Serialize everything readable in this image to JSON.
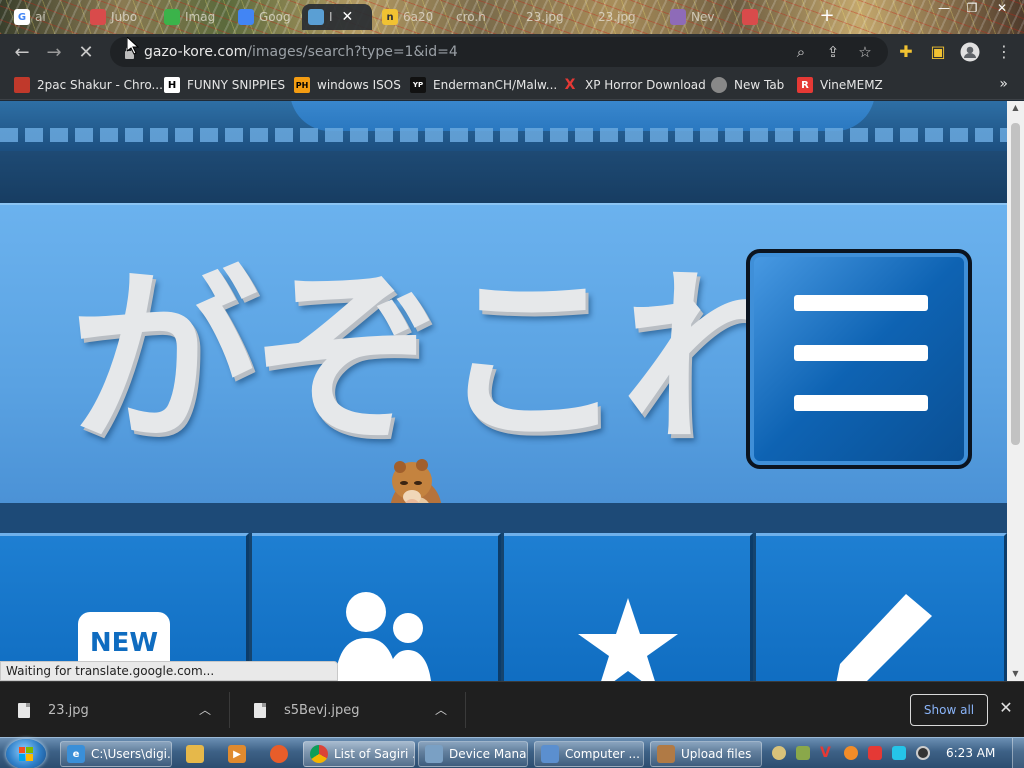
{
  "browser": {
    "tabs": [
      {
        "title": "ai",
        "icon": "google-icon",
        "color": "#ffffff"
      },
      {
        "title": "Jubo",
        "icon": "tab-icon",
        "color": "#d94b4b"
      },
      {
        "title": "Imag",
        "icon": "tab-icon",
        "color": "#3bb34a"
      },
      {
        "title": "Goog",
        "icon": "tab-icon",
        "color": "#4285f4"
      },
      {
        "title": "I",
        "icon": "tab-icon",
        "color": "#5a9fd4",
        "active": true
      },
      {
        "title": "6a20",
        "icon": "tab-icon",
        "color": "#f1c232"
      },
      {
        "title": "cro.h",
        "icon": "tab-icon",
        "color": "#777777"
      },
      {
        "title": "23.jpg",
        "icon": "tab-icon",
        "color": "#777777"
      },
      {
        "title": "23.jpg",
        "icon": "tab-icon",
        "color": "#777777"
      },
      {
        "title": "Nev",
        "icon": "tab-icon",
        "color": "#8e6bb8"
      },
      {
        "title": "",
        "icon": "tab-icon",
        "color": "#d94b4b"
      }
    ],
    "address": {
      "domain": "gazo-kore.com",
      "path": "/images/search?type=1&id=4"
    },
    "bookmarks": [
      {
        "label": "2pac Shakur - Chro...",
        "badge": "",
        "color": "#c0392b"
      },
      {
        "label": "FUNNY SNIPPIES",
        "badge": "H",
        "color": "#ffffff"
      },
      {
        "label": "windows ISOS",
        "badge": "PH",
        "color": "#f39c12"
      },
      {
        "label": "EndermanCH/Malw...",
        "badge": "YP",
        "color": "#222222"
      },
      {
        "label": "XP Horror Download",
        "badge": "X",
        "color": "#e53935"
      },
      {
        "label": "New Tab",
        "badge": "",
        "color": "#888888"
      },
      {
        "label": "VineMEMZ",
        "badge": "R",
        "color": "#e53935"
      }
    ],
    "bookmarks_more": "»",
    "status_text": "Waiting for translate.google.com..."
  },
  "site": {
    "logo_text": "がぞこれ",
    "tile_new_label": "NEW",
    "accent_color": "#0f6cc0"
  },
  "downloads": {
    "items": [
      {
        "name": "23.jpg"
      },
      {
        "name": "s5Bevj.jpeg"
      }
    ],
    "show_all_label": "Show all"
  },
  "taskbar": {
    "items": [
      {
        "label": "C:\\Users\\digi...",
        "color": "#3a8fd8"
      },
      {
        "label": "",
        "color": "#e6b84a"
      },
      {
        "label": "",
        "color": "#e08a2e"
      },
      {
        "label": "",
        "color": "#e85d2a"
      },
      {
        "label": "List of Sagiri ...",
        "color": "#ffffff"
      },
      {
        "label": "Device Mana...",
        "color": "#7aa0c4"
      },
      {
        "label": "Computer ...",
        "color": "#5b8fcf"
      },
      {
        "label": "Upload files",
        "color": "#b07a45"
      }
    ],
    "clock": "6:23 AM"
  }
}
